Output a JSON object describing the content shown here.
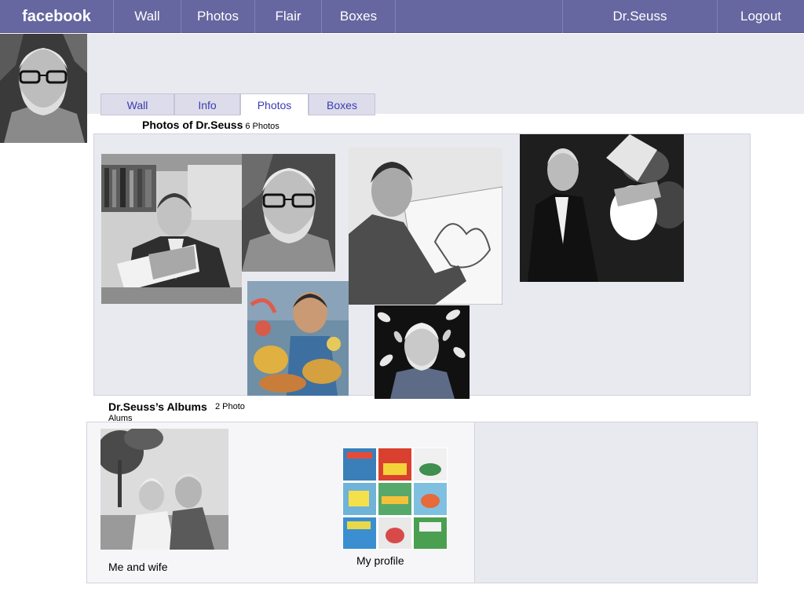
{
  "topbar": {
    "logo": "facebook",
    "nav": [
      "Wall",
      "Photos",
      "Flair",
      "Boxes"
    ],
    "user": "Dr.Seuss",
    "logout": "Logout"
  },
  "subtabs": [
    "Wall",
    "Info",
    "Photos",
    "Boxes"
  ],
  "active_subtab": "Photos",
  "photos_section": {
    "title": "Photos of Dr.Seuss",
    "count": "6 Photos"
  },
  "albums_section": {
    "title": "Dr.Seuss’s Albums",
    "count_line1": "2 Photo",
    "count_line2": "Alums",
    "albums": [
      {
        "caption": "Me and wife"
      },
      {
        "caption": "My profile"
      }
    ]
  },
  "colors": {
    "topbar": "#6666a0",
    "panel": "#e9e9f0",
    "tab_text": "#3b3bb3"
  }
}
